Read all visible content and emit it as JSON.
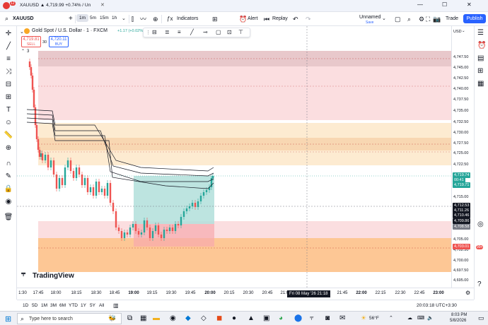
{
  "window": {
    "tab_title": "XAUUSD ▲ 4,719.99 +0.74% / Un",
    "notification_count": "12",
    "controls": [
      "minimize",
      "maximize",
      "close"
    ]
  },
  "toolbar": {
    "symbol": "XAUUSD",
    "intervals": [
      "1m",
      "5m",
      "15m",
      "1h"
    ],
    "active_interval": "1m",
    "indicators_label": "Indicators",
    "alert_label": "Alert",
    "replay_label": "Replay",
    "layout_name": "Unnamed",
    "layout_status": "Save",
    "trade_label": "Trade",
    "publish_label": "Publish"
  },
  "legend": {
    "instrument": "Gold Spot / U.S. Dollar · 1 · FXCM",
    "change": "+1.17 (+0.02%)",
    "sell_price": "4,719.81",
    "sell_label": "SELL",
    "spread": "30",
    "buy_price": "4,720.11",
    "buy_label": "BUY",
    "indicator_count": "3"
  },
  "price_axis": {
    "currency": "USD",
    "ticks": [
      "4,747.50",
      "4,745.00",
      "4,742.50",
      "4,740.00",
      "4,737.50",
      "4,735.00",
      "4,732.50",
      "4,730.00",
      "4,727.50",
      "4,725.00",
      "4,722.50",
      "4,717.50",
      "4,715.00",
      "4,705.00",
      "4,702.50",
      "4,700.00",
      "4,697.50",
      "4,695.00"
    ],
    "badges": [
      {
        "text": "4,719.74",
        "color": "#26a69a"
      },
      {
        "text": "00:41",
        "color": "#26a69a"
      },
      {
        "text": "4,719.71",
        "color": "#26a69a"
      },
      {
        "text": "4,712.53",
        "color": "#131722"
      },
      {
        "text": "4,711.26",
        "color": "#131722"
      },
      {
        "text": "4,710.46",
        "color": "#131722"
      },
      {
        "text": "4,709.86",
        "color": "#131722"
      },
      {
        "text": "4,708.58",
        "color": "#787b86"
      },
      {
        "text": "4,703.01",
        "color": "#ef5350"
      }
    ]
  },
  "time_axis": {
    "labels": [
      "1:30",
      "17:45",
      "18:00",
      "18:15",
      "18:30",
      "18:45",
      "19:00",
      "19:15",
      "19:30",
      "19:45",
      "20:00",
      "20:15",
      "20:30",
      "20:45",
      "21:00",
      "21:45",
      "22:00",
      "22:15",
      "22:30",
      "22:45",
      "23:00"
    ],
    "crosshair_label": "Fri 08 May '26  21:18"
  },
  "bottom_bar": {
    "ranges": [
      "1D",
      "5D",
      "1M",
      "3M",
      "6M",
      "YTD",
      "1Y",
      "5Y",
      "All"
    ],
    "clock": "20:03:18 UTC+3:30"
  },
  "chart_overlay": {
    "watermark": "TradingView"
  },
  "taskbar": {
    "search_placeholder": "Type here to search",
    "weather": "56°F",
    "time": "8:03 PM",
    "date": "5/8/2026"
  },
  "colors": {
    "up": "#26a69a",
    "down": "#ef5350",
    "accent": "#2962ff"
  }
}
